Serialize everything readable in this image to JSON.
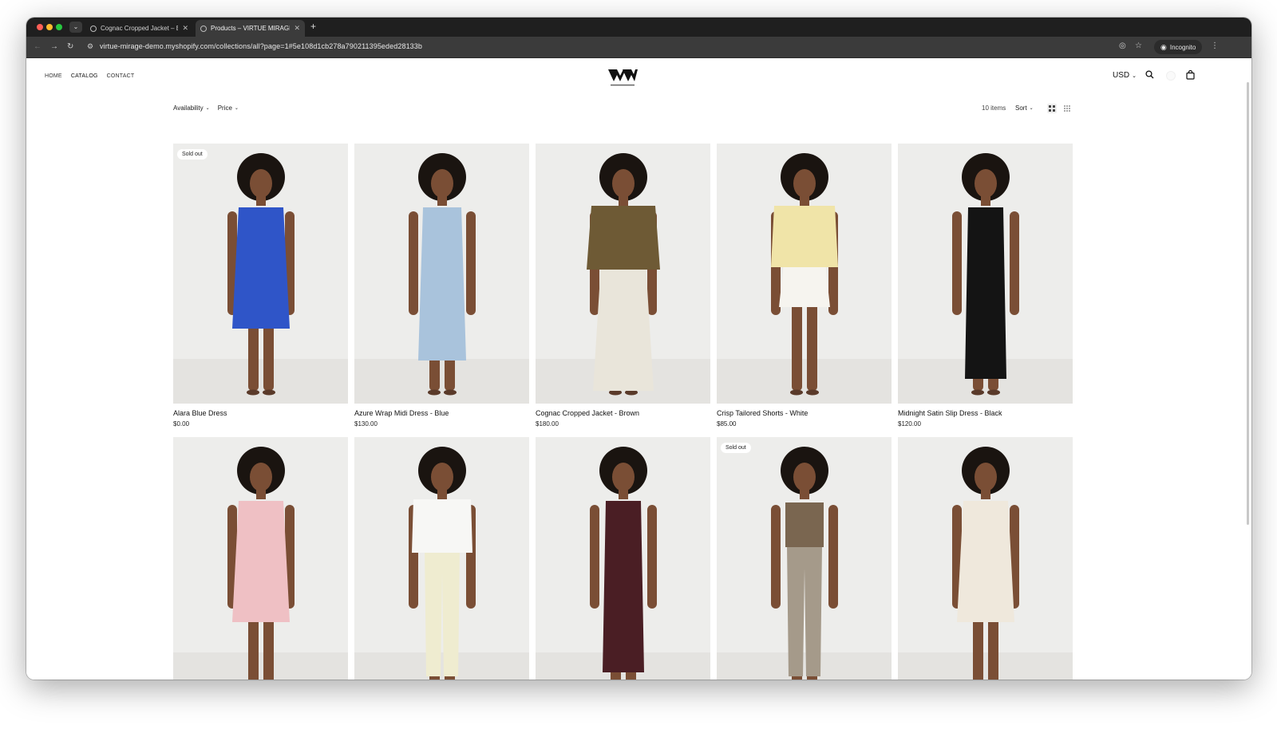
{
  "browser": {
    "tabs": [
      {
        "title": "Cognac Cropped Jacket – Br"
      },
      {
        "title": "Products – VIRTUE MIRAGE D"
      }
    ],
    "url": "virtue-mirage-demo.myshopify.com/collections/all?page=1#5e108d1cb278a790211395eded28133b",
    "incognito_label": "Incognito"
  },
  "nav": {
    "links": [
      "HOME",
      "CATALOG",
      "CONTACT"
    ],
    "currency": "USD"
  },
  "collection": {
    "filters": [
      "Availability",
      "Price"
    ],
    "item_count": "10 items",
    "sort_label": "Sort"
  },
  "products": [
    {
      "name": "Alara Blue Dress",
      "price": "$0.00",
      "badge": "Sold out",
      "garment_color": "#2f55c8",
      "garment": "dress-short"
    },
    {
      "name": "Azure Wrap Midi Dress - Blue",
      "price": "$130.00",
      "badge": "",
      "garment_color": "#a9c3dc",
      "garment": "dress-midi"
    },
    {
      "name": "Cognac Cropped Jacket - Brown",
      "price": "$180.00",
      "badge": "",
      "garment_color": "#6e5a35",
      "garment": "jacket-skirt"
    },
    {
      "name": "Crisp Tailored Shorts - White",
      "price": "$85.00",
      "badge": "",
      "garment_color": "#f0e4a8",
      "garment": "shirt-shorts"
    },
    {
      "name": "Midnight Satin Slip Dress - Black",
      "price": "$120.00",
      "badge": "",
      "garment_color": "#141414",
      "garment": "dress-long"
    },
    {
      "name": "",
      "price": "",
      "badge": "",
      "garment_color": "#efc0c4",
      "garment": "dress-short"
    },
    {
      "name": "",
      "price": "",
      "badge": "",
      "garment_color": "#efecd0",
      "garment": "blouse-pants"
    },
    {
      "name": "",
      "price": "",
      "badge": "",
      "garment_color": "#4a1e24",
      "garment": "dress-long"
    },
    {
      "name": "",
      "price": "",
      "badge": "Sold out",
      "garment_color": "#7a6650",
      "garment": "top-pants"
    },
    {
      "name": "",
      "price": "",
      "badge": "",
      "garment_color": "#efe8dc",
      "garment": "dress-short"
    }
  ]
}
